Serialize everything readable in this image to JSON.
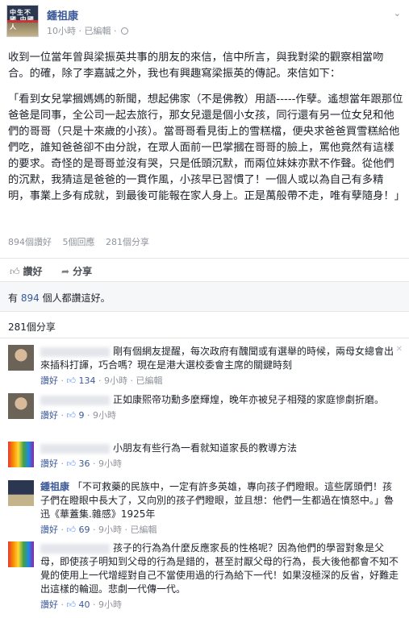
{
  "post": {
    "author": "鍾祖康",
    "time": "10小時",
    "edited": "已編輯",
    "avatar_text": "中生不國\n中國人",
    "paragraphs": [
      "收到一位當年曾與梁振英共事的朋友的來信，信中所言，與我對梁的觀察相當吻合。的確，除了李嘉誠之外，我也有興趣寫梁振英的傳記。來信如下：",
      "「看到女兒掌摑媽媽的新聞，想起佛家（不是佛教）用語-----作孽。遙想當年跟那位爸爸是同事，全公司一起去旅行，那女兒還是個小女孩，同行還有另一位女兒和他們的哥哥（只是十來歲的小孩）。當哥哥看見街上的雪糕檔，便央求爸爸買雪糕給他們吃，誰知爸爸卻不由分說，在眾人面前一巴掌摑在哥哥的臉上，罵他竟然有這樣的要求。奇怪的是哥哥並沒有哭，只是低頭沉默，而兩位妹妹亦默不作聲。從他們的沉默，我猜這是爸爸的一貫作風，小孩早已習慣了！一個人或以為自己有多精明，事業上多有成就，到最後可能報在家人身上。正是萬般帶不走，唯有孽隨身！」"
    ],
    "stats": {
      "likes": "894個讚好",
      "comments": "5個回應",
      "shares": "281個分享"
    }
  },
  "actions": {
    "like": "讚好",
    "share": "分享"
  },
  "likes_summary": {
    "prefix": "有",
    "count": "894",
    "suffix": "個人都讚這好。"
  },
  "shares_header": "281個分享",
  "comments": [
    {
      "name": "",
      "avatar": "face",
      "text": "剛有個網友提醒，每次政府有醜聞或有選舉的時候，兩母女總會出來插科打諢，巧合嗎？現在是港大選校委會主席的關鍵時刻",
      "like": "讚好",
      "count": "134",
      "time": "9小時",
      "edited": "已編輯"
    },
    {
      "name": "",
      "avatar": "face",
      "text": "正如康熙帝功勳多麼輝煌，晚年亦被兒子相殘的家庭慘劇折磨。",
      "like": "讚好",
      "count": "9",
      "time": "9小時",
      "edited": ""
    },
    {
      "name": "",
      "avatar": "rainbow",
      "text": "小朋友有些行為一看就知道家長的教導方法",
      "like": "讚好",
      "count": "36",
      "time": "9小時",
      "edited": ""
    },
    {
      "name": "鍾祖康",
      "avatar": "poster",
      "text": "「不可救藥的民族中，一定有許多英雄，專向孩子們瞪眼。這些孱頭們！孩子們在瞪眼中長大了，又向別的孩子們瞪眼，並且想：他們一生都過在憤怒中。」魯迅《華蓋集.雜感》1925年",
      "like": "讚好",
      "count": "69",
      "time": "9小時",
      "edited": "已編輯"
    },
    {
      "name": "",
      "avatar": "rainbow",
      "text": "孩子的行為為什麼反應家長的性格呢？因為他們的學習對象是父母，即使孩子明知到父母的行為是錯的，甚至討厭父母的行為，長大後他都會不知不覺的使用上一代增經對自己不當使用過的行為給下一代！如果沒極深的反省，好難走出這樣的輪迴。悲劇一代傳一代。",
      "like": "讚好",
      "count": "40",
      "time": "9小時",
      "edited": ""
    }
  ]
}
